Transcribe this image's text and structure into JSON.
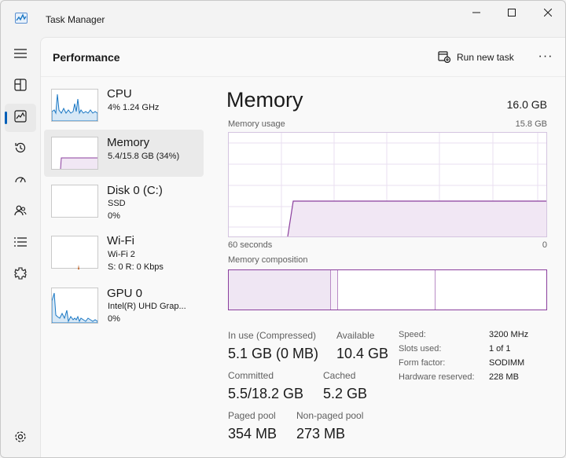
{
  "window": {
    "title": "Task Manager",
    "icon": "task-manager-icon",
    "controls": [
      "minimize-icon",
      "maximize-icon",
      "close-icon"
    ]
  },
  "rail": {
    "items": [
      {
        "icon": "hamburger-menu-icon"
      },
      {
        "icon": "processes-icon"
      },
      {
        "icon": "performance-icon",
        "active": true
      },
      {
        "icon": "app-history-icon"
      },
      {
        "icon": "startup-apps-icon"
      },
      {
        "icon": "users-icon"
      },
      {
        "icon": "details-icon"
      },
      {
        "icon": "services-icon"
      },
      {
        "icon": "settings-icon"
      }
    ],
    "accent": "#005fb8"
  },
  "header": {
    "title": "Performance",
    "run_new_task": "Run new task",
    "more": "···"
  },
  "devices": [
    {
      "name": "CPU",
      "line1": "4%  1.24 GHz",
      "line2": "",
      "color": "#1b78c4"
    },
    {
      "name": "Memory",
      "line1": "5.4/15.8 GB (34%)",
      "line2": "",
      "color": "#8b3f9e",
      "selected": true
    },
    {
      "name": "Disk 0 (C:)",
      "line1": "SSD",
      "line2": "0%",
      "color": "#4d9b4d"
    },
    {
      "name": "Wi-Fi",
      "line1": "Wi-Fi 2",
      "line2": "S: 0  R: 0 Kbps",
      "color": "#c0662b"
    },
    {
      "name": "GPU 0",
      "line1": "Intel(R) UHD Grap...",
      "line2": "0%",
      "color": "#1b78c4"
    }
  ],
  "memory": {
    "title": "Memory",
    "total": "16.0 GB",
    "usage_label": "Memory usage",
    "usage_max": "15.8 GB",
    "time_left": "60 seconds",
    "time_right": "0",
    "composition_label": "Memory composition",
    "color": "#8b3f9e",
    "fill": "#f1e7f4",
    "usage_fraction": 0.34
  },
  "stats": {
    "in_use_label": "In use (Compressed)",
    "in_use_value": "5.1 GB (0 MB)",
    "available_label": "Available",
    "available_value": "10.4 GB",
    "committed_label": "Committed",
    "committed_value": "5.5/18.2 GB",
    "cached_label": "Cached",
    "cached_value": "5.2 GB",
    "paged_label": "Paged pool",
    "paged_value": "354 MB",
    "nonpaged_label": "Non-paged pool",
    "nonpaged_value": "273 MB"
  },
  "specs": [
    {
      "label": "Speed:",
      "value": "3200 MHz"
    },
    {
      "label": "Slots used:",
      "value": "1 of 1"
    },
    {
      "label": "Form factor:",
      "value": "SODIMM"
    },
    {
      "label": "Hardware reserved:",
      "value": "228 MB"
    }
  ]
}
